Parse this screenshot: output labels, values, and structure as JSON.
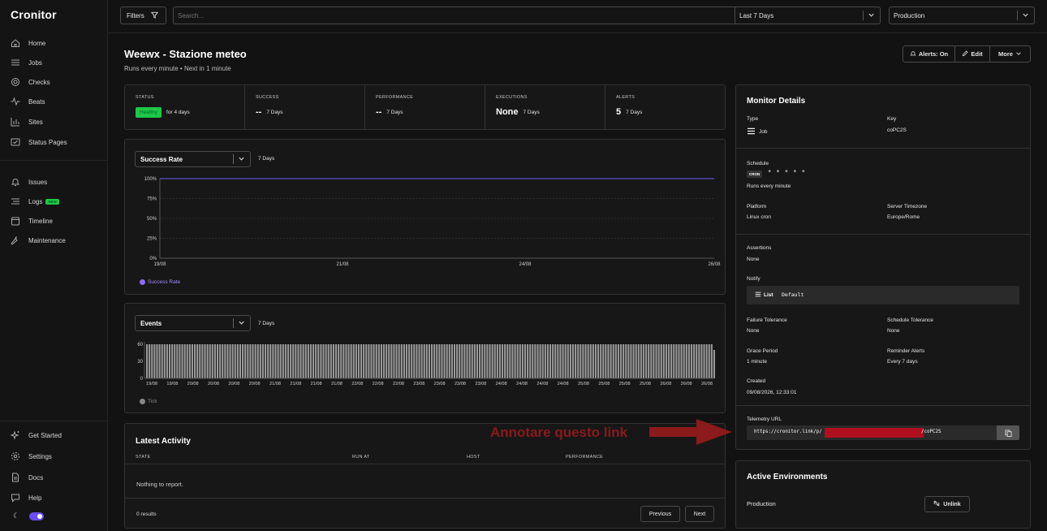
{
  "sidebar": {
    "logo": "Cronitor",
    "nav": [
      {
        "label": "Home",
        "icon": "home-icon"
      },
      {
        "label": "Jobs",
        "icon": "list-icon"
      },
      {
        "label": "Checks",
        "icon": "check-icon"
      },
      {
        "label": "Beats",
        "icon": "heartbeat-icon"
      },
      {
        "label": "Sites",
        "icon": "bar-chart-icon"
      },
      {
        "label": "Status Pages",
        "icon": "status-page-icon"
      }
    ],
    "nav2": [
      {
        "label": "Issues",
        "icon": "bell-icon"
      },
      {
        "label": "Logs",
        "icon": "logs-icon",
        "badge": "NEW"
      },
      {
        "label": "Timeline",
        "icon": "calendar-icon"
      },
      {
        "label": "Maintenance",
        "icon": "wrench-icon"
      }
    ],
    "bottom": [
      {
        "label": "Get Started",
        "icon": "sparkle-icon"
      },
      {
        "label": "Settings",
        "icon": "gear-icon"
      },
      {
        "label": "Docs",
        "icon": "document-icon"
      },
      {
        "label": "Help",
        "icon": "chat-icon"
      }
    ]
  },
  "topbar": {
    "filters_label": "Filters",
    "search_placeholder": "Search...",
    "range": "Last 7 Days",
    "environment": "Production"
  },
  "header": {
    "title": "Weewx - Stazione meteo",
    "subtitle": "Runs every minute  •  Next in 1 minute",
    "alerts_btn": "Alerts: On",
    "edit_btn": "Edit",
    "more_btn": "More"
  },
  "stats": {
    "status_label": "STATUS",
    "status_badge": "Healthy",
    "status_text": "for 4 days",
    "success_label": "SUCCESS",
    "success_val": "--",
    "success_period": "7 Days",
    "performance_label": "PERFORMANCE",
    "performance_val": "--",
    "performance_period": "7 Days",
    "executions_label": "EXECUTIONS",
    "executions_val": "None",
    "executions_period": "7 Days",
    "alerts_label": "ALERTS",
    "alerts_val": "5",
    "alerts_period": "7 Days"
  },
  "success_chart": {
    "select": "Success Rate",
    "period": "7 Days",
    "legend": "Success Rate",
    "legend_color": "#8b6cf0",
    "y_ticks": [
      "100%",
      "75%",
      "50%",
      "25%",
      "0%"
    ],
    "x_ticks": [
      "19/08",
      "21/08",
      "24/08",
      "26/08"
    ]
  },
  "events_chart": {
    "select": "Events",
    "period": "7 Days",
    "legend": "Tick",
    "y_ticks": [
      "60",
      "30",
      "0"
    ],
    "x_ticks": [
      "19/08",
      "19/08",
      "20/08",
      "20/08",
      "20/08",
      "20/08",
      "21/08",
      "21/08",
      "21/08",
      "21/08",
      "22/08",
      "22/08",
      "22/08",
      "23/08",
      "23/08",
      "23/08",
      "23/08",
      "24/08",
      "24/08",
      "24/08",
      "24/08",
      "25/08",
      "25/08",
      "25/08",
      "25/08",
      "26/08",
      "26/08",
      "26/08"
    ]
  },
  "chart_data": [
    {
      "type": "line",
      "title": "Success Rate",
      "x": [
        "19/08",
        "21/08",
        "24/08",
        "26/08"
      ],
      "series": [
        {
          "name": "Success Rate",
          "values": [
            100,
            100,
            100,
            100
          ]
        }
      ],
      "ylim": [
        0,
        100
      ],
      "color": "#6b5cf0"
    },
    {
      "type": "bar",
      "title": "Events",
      "series": [
        {
          "name": "Tick",
          "values": [
            60,
            60,
            60,
            60,
            60,
            60,
            60,
            60,
            60,
            60,
            60,
            60,
            60,
            60,
            60,
            60,
            60,
            60,
            60,
            60,
            60,
            60,
            60,
            60,
            60,
            60,
            60,
            60,
            60,
            60,
            60,
            60,
            60,
            60,
            60,
            60,
            60,
            60,
            60,
            60,
            60,
            60,
            60,
            60,
            60,
            60,
            60,
            60,
            60,
            60,
            60,
            60,
            60,
            60,
            60,
            60,
            60,
            60,
            60,
            60,
            60,
            60,
            60,
            60,
            60,
            60,
            60,
            60,
            60,
            60,
            60,
            60,
            60,
            60,
            60,
            60,
            60,
            60,
            60,
            60,
            60,
            60,
            60,
            60,
            60,
            60,
            60,
            60,
            60,
            60,
            60,
            60,
            60,
            60,
            60,
            60,
            60,
            60,
            60,
            60,
            60,
            60,
            60,
            60,
            60,
            60,
            60,
            60,
            60,
            60,
            60,
            60,
            60,
            60,
            60,
            60,
            60,
            60,
            60,
            60,
            60,
            60,
            60,
            60,
            60,
            60,
            60,
            60,
            60,
            60,
            60,
            60,
            60,
            60,
            60,
            60,
            60,
            60,
            60,
            60,
            60,
            60,
            60,
            60,
            60,
            60,
            60,
            60,
            60,
            60,
            60,
            60,
            60,
            60,
            60,
            60,
            60,
            60,
            60,
            60,
            60,
            60,
            60,
            60,
            60,
            60,
            60,
            60,
            60,
            60,
            60,
            60,
            60,
            60,
            60,
            60,
            60,
            60,
            60,
            60,
            60,
            60,
            60,
            60,
            60,
            60,
            60,
            60,
            60,
            60,
            60,
            60,
            60,
            60,
            60,
            60,
            60,
            60,
            60,
            60,
            60,
            60,
            60,
            60,
            60,
            60,
            60,
            60,
            60,
            60,
            60,
            60,
            60,
            60,
            60,
            60,
            60,
            60,
            60,
            60,
            60,
            60,
            60,
            60,
            60,
            50
          ]
        }
      ],
      "ylim": [
        0,
        60
      ],
      "color": "#9a9a9a"
    }
  ],
  "activity": {
    "title": "Latest Activity",
    "cols": [
      "STATE",
      "RUN AT",
      "HOST",
      "PERFORMANCE"
    ],
    "empty": "Nothing to report.",
    "count": "0 results",
    "prev": "Previous",
    "next": "Next"
  },
  "details": {
    "title": "Monitor Details",
    "type_label": "Type",
    "type_val": "Job",
    "key_label": "Key",
    "key_val": "coPC2S",
    "schedule_label": "Schedule",
    "cron_tag": "CRON",
    "cron_expr": "* * * * *",
    "schedule_text": "Runs every minute",
    "platform_label": "Platform",
    "platform_val": "Linux cron",
    "tz_label": "Server Timezone",
    "tz_val": "Europe/Rome",
    "assertions_label": "Assertions",
    "assertions_val": "None",
    "notify_label": "Notify",
    "notify_list": "List",
    "notify_val": "Default",
    "failure_label": "Failure Tolerance",
    "failure_val": "None",
    "sched_tol_label": "Schedule Tolerance",
    "sched_tol_val": "None",
    "grace_label": "Grace Period",
    "grace_val": "1 minute",
    "reminder_label": "Reminder Alerts",
    "reminder_val": "Every 7 days",
    "created_label": "Created",
    "created_val": "09/08/2026, 12:33:01",
    "telemetry_label": "Telemetry URL",
    "telemetry_prefix": "https://cronitor.link/p/",
    "telemetry_suffix": "/coPC2S"
  },
  "environments": {
    "title": "Active Environments",
    "env": "Production",
    "unlink": "Unlink"
  },
  "annotation": "Annotare questo link"
}
